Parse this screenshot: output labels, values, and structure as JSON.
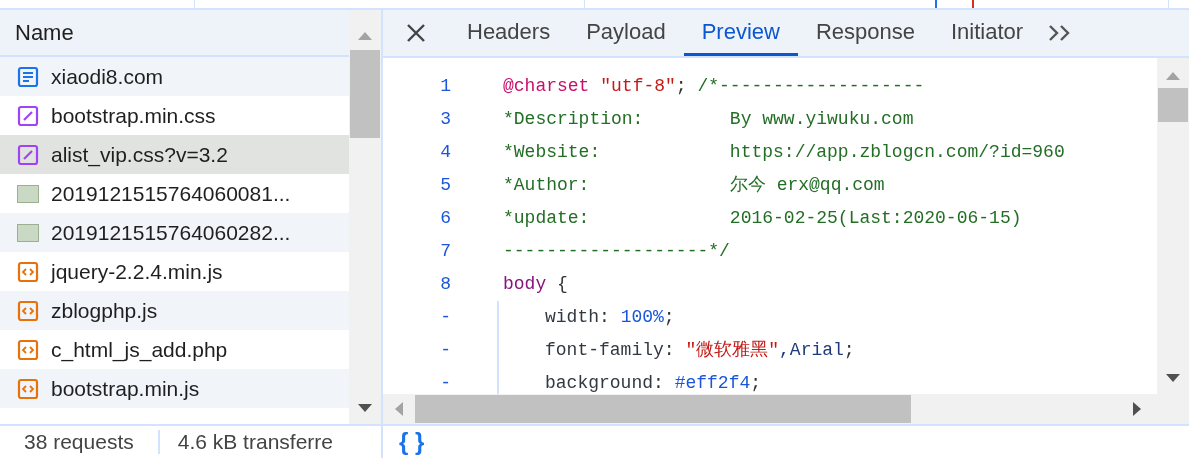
{
  "requests": {
    "column": "Name",
    "rows": [
      {
        "name": "xiaodi8.com",
        "kind": "document",
        "selected": false
      },
      {
        "name": "bootstrap.min.css",
        "kind": "stylesheet",
        "selected": false
      },
      {
        "name": "alist_vip.css?v=3.2",
        "kind": "stylesheet",
        "selected": true
      },
      {
        "name": "2019121515764060081...",
        "kind": "image",
        "selected": false
      },
      {
        "name": "2019121515764060282...",
        "kind": "image",
        "selected": false
      },
      {
        "name": "jquery-2.2.4.min.js",
        "kind": "script",
        "selected": false
      },
      {
        "name": "zblogphp.js",
        "kind": "script",
        "selected": false
      },
      {
        "name": "c_html_js_add.php",
        "kind": "script",
        "selected": false
      },
      {
        "name": "bootstrap.min.js",
        "kind": "script",
        "selected": false
      }
    ]
  },
  "status_bar": [
    "38 requests",
    "4.6 kB transferre"
  ],
  "tabs": [
    {
      "label": "Headers",
      "selected": false
    },
    {
      "label": "Payload",
      "selected": false
    },
    {
      "label": "Preview",
      "selected": true
    },
    {
      "label": "Response",
      "selected": false
    },
    {
      "label": "Initiator",
      "selected": false
    }
  ],
  "code": [
    {
      "gutter": "1",
      "indented": false,
      "tokens": [
        {
          "kind": "at-rule",
          "text": "@charset"
        },
        {
          "kind": "string",
          "text": " \"utf-8\""
        },
        {
          "kind": "punct",
          "text": "; "
        },
        {
          "kind": "comment",
          "text": "/*-------------------"
        }
      ]
    },
    {
      "gutter": "3",
      "indented": false,
      "tokens": [
        {
          "kind": "comment",
          "text": "*Description:        By www.yiwuku.com"
        }
      ]
    },
    {
      "gutter": "4",
      "indented": false,
      "tokens": [
        {
          "kind": "comment",
          "text": "*Website:            https://app.zblogcn.com/?id=960"
        }
      ]
    },
    {
      "gutter": "5",
      "indented": false,
      "tokens": [
        {
          "kind": "comment",
          "text": "*Author:             尔今 erx@qq.com"
        }
      ]
    },
    {
      "gutter": "6",
      "indented": false,
      "tokens": [
        {
          "kind": "comment",
          "text": "*update:             2016-02-25(Last:2020-06-15)"
        }
      ]
    },
    {
      "gutter": "7",
      "indented": false,
      "tokens": [
        {
          "kind": "comment",
          "text": "-------------------*/"
        }
      ]
    },
    {
      "gutter": "8",
      "indented": false,
      "tokens": [
        {
          "kind": "selector",
          "text": "body"
        },
        {
          "kind": "punct",
          "text": " {"
        }
      ]
    },
    {
      "gutter": "-",
      "indented": true,
      "tokens": [
        {
          "kind": "property",
          "text": "width"
        },
        {
          "kind": "punct",
          "text": ": "
        },
        {
          "kind": "number",
          "text": "100%"
        },
        {
          "kind": "punct",
          "text": ";"
        }
      ]
    },
    {
      "gutter": "-",
      "indented": true,
      "tokens": [
        {
          "kind": "property",
          "text": "font-family"
        },
        {
          "kind": "punct",
          "text": ": "
        },
        {
          "kind": "string",
          "text": "\"微软雅黑\""
        },
        {
          "kind": "value",
          "text": ",Arial"
        },
        {
          "kind": "punct",
          "text": ";"
        }
      ]
    },
    {
      "gutter": "-",
      "indented": true,
      "tokens": [
        {
          "kind": "property",
          "text": "background"
        },
        {
          "kind": "punct",
          "text": ": "
        },
        {
          "kind": "number",
          "text": "#eff2f4"
        },
        {
          "kind": "punct",
          "text": ";"
        }
      ]
    }
  ],
  "bottom_toolbar": {
    "format_button": "{ }"
  }
}
